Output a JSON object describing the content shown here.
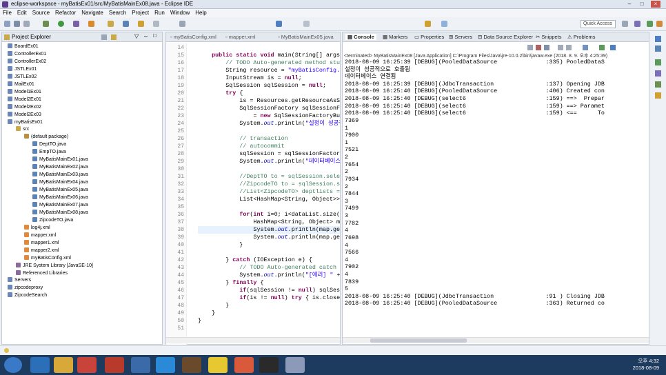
{
  "window": {
    "title": "eclipse-workspace - myBatisEx01/src/MyBatisMainEx08.java - Eclipse IDE"
  },
  "menu": [
    "File",
    "Edit",
    "Source",
    "Refactor",
    "Navigate",
    "Search",
    "Project",
    "Run",
    "Window",
    "Help"
  ],
  "toolbar": {
    "quick_access": "Quick Access"
  },
  "project_explorer": {
    "title": "Project Explorer",
    "nodes": [
      {
        "label": "BoardEx01",
        "depth": 0,
        "kind": "project"
      },
      {
        "label": "ControllerEx01",
        "depth": 0,
        "kind": "project"
      },
      {
        "label": "ControllerEx02",
        "depth": 0,
        "kind": "project"
      },
      {
        "label": "JSTLEx01",
        "depth": 0,
        "kind": "project"
      },
      {
        "label": "JSTLEx02",
        "depth": 0,
        "kind": "project"
      },
      {
        "label": "MailEx01",
        "depth": 0,
        "kind": "project"
      },
      {
        "label": "Model1Ex01",
        "depth": 0,
        "kind": "project"
      },
      {
        "label": "Model2Ex01",
        "depth": 0,
        "kind": "project"
      },
      {
        "label": "Model2Ex02",
        "depth": 0,
        "kind": "project"
      },
      {
        "label": "Model2Ex03",
        "depth": 0,
        "kind": "project"
      },
      {
        "label": "myBatisEx01",
        "depth": 0,
        "kind": "project"
      },
      {
        "label": "src",
        "depth": 1,
        "kind": "folder"
      },
      {
        "label": "(default package)",
        "depth": 2,
        "kind": "package"
      },
      {
        "label": "DeptTO.java",
        "depth": 3,
        "kind": "java"
      },
      {
        "label": "EmpTO.java",
        "depth": 3,
        "kind": "java"
      },
      {
        "label": "MyBatisMainEx01.java",
        "depth": 3,
        "kind": "java"
      },
      {
        "label": "MyBatisMainEx02.java",
        "depth": 3,
        "kind": "java"
      },
      {
        "label": "MyBatisMainEx03.java",
        "depth": 3,
        "kind": "java"
      },
      {
        "label": "MyBatisMainEx04.java",
        "depth": 3,
        "kind": "java"
      },
      {
        "label": "MyBatisMainEx05.java",
        "depth": 3,
        "kind": "java"
      },
      {
        "label": "MyBatisMainEx06.java",
        "depth": 3,
        "kind": "java"
      },
      {
        "label": "MyBatisMainEx07.java",
        "depth": 3,
        "kind": "java"
      },
      {
        "label": "MyBatisMainEx08.java",
        "depth": 3,
        "kind": "java"
      },
      {
        "label": "ZipcodeTO.java",
        "depth": 3,
        "kind": "java"
      },
      {
        "label": "log4j.xml",
        "depth": 2,
        "kind": "xml"
      },
      {
        "label": "mapper.xml",
        "depth": 2,
        "kind": "xml"
      },
      {
        "label": "mapper1.xml",
        "depth": 2,
        "kind": "xml"
      },
      {
        "label": "mapper2.xml",
        "depth": 2,
        "kind": "xml"
      },
      {
        "label": "myBatisConfig.xml",
        "depth": 2,
        "kind": "xml"
      },
      {
        "label": "JRE System Library [JavaSE-10]",
        "depth": 1,
        "kind": "lib"
      },
      {
        "label": "Referenced Libraries",
        "depth": 1,
        "kind": "lib"
      },
      {
        "label": "Servers",
        "depth": 0,
        "kind": "project"
      },
      {
        "label": "zipcodeproxy",
        "depth": 0,
        "kind": "project"
      },
      {
        "label": "ZipcodeSearch",
        "depth": 0,
        "kind": "project"
      }
    ]
  },
  "editor": {
    "tabs": [
      "myBatisConfig.xml",
      "mapper.xml",
      "MyBatisMainEx05.java"
    ],
    "line_numbers": [
      "14",
      "15",
      "16",
      "17",
      "18",
      "19",
      "20",
      "21",
      "22",
      "23",
      "24",
      "25",
      "26",
      "27",
      "28",
      "29",
      "30",
      "31",
      "32",
      "33",
      "34",
      "35",
      "36",
      "37",
      "38",
      "39",
      "40",
      "41",
      "42",
      "43",
      "44",
      "45",
      "46",
      "47",
      "48",
      "49",
      "50",
      "51"
    ],
    "lines": [
      "",
      "    public static void main(String[] args)",
      "        // TODO Auto-generated method stub",
      "        String resource = \"myBatisConfig.x",
      "        InputStream is = null;",
      "        SqlSession sqlSession = null;",
      "        try {",
      "            is = Resources.getResourceAsSt",
      "            SqlSessionFactory sqlSessionFa",
      "                = new SqlSessionFactoryBui",
      "            System.out.println(\"설정이 성공적으",
      "",
      "            // transaction",
      "            // autocommit",
      "            sqlSession = sqlSessionFactory.",
      "            System.out.println(\"데이터베이스 연",
      "",
      "            //DeptTO to = sqlSession.selec",
      "            //ZipcodeTO to = sqlSession.se",
      "            //List<ZipcodeTO> deptlists =",
      "            List<HashMap<String, Object>>",
      "",
      "            for(int i=0; i<dataList.size()",
      "                HashMap<String, Object> ma",
      "                System.out.println(map.get",
      "                System.out.println(map.get",
      "            }",
      "",
      "        } catch (IOException e) {",
      "            // TODO Auto-generated catch b",
      "            System.out.println(\"[에러] \" + (",
      "        } finally {",
      "            if(sqlSession != null) sqlSess",
      "            if(is != null) try { is.close(",
      "        }",
      "    }",
      "}",
      ""
    ]
  },
  "console": {
    "tabs": [
      "Console",
      "Markers",
      "Properties",
      "Servers",
      "Data Source Explorer",
      "Snippets",
      "Problems"
    ],
    "launch_info": "<terminated> MyBatisMainEx08 [Java Application] C:\\Program Files\\Java\\jre-10.0.2\\bin\\javaw.exe (2018. 8. 9. 오후 4:25:39)",
    "lines": [
      "2018-08-09 16:25:39 [DEBUG](PooledDataSource              :335) PooledDataS",
      "설정이 성공적으로 호출됨",
      "데이터베이스 연결됨",
      "2018-08-09 16:25:39 [DEBUG](JdbcTransaction               :137) Opening JDB",
      "2018-08-09 16:25:40 [DEBUG](PooledDataSource              :406) Created con",
      "2018-08-09 16:25:40 [DEBUG](select6                       :159) ==>  Prepar",
      "2018-08-09 16:25:40 [DEBUG](select6                       :159) ==> Paramet",
      "2018-08-09 16:25:40 [DEBUG](select6                       :159) <==      To",
      "7369",
      "1",
      "7900",
      "1",
      "7521",
      "2",
      "7654",
      "2",
      "7934",
      "2",
      "7844",
      "3",
      "7499",
      "3",
      "7782",
      "4",
      "7698",
      "4",
      "7566",
      "4",
      "7902",
      "4",
      "7839",
      "5",
      "2018-08-09 16:25:40 [DEBUG](JdbcTransaction               :91 ) Closing JDB",
      "2018-08-09 16:25:40 [DEBUG](PooledDataSource              :363) Returned co"
    ]
  },
  "taskbar": {
    "time": "오후 4:32",
    "date": "2018-08-09"
  },
  "colors": {
    "accent": "#1d3a5f",
    "keyword": "#7f0055",
    "comment": "#3f7f5f",
    "string": "#2a00ff"
  }
}
